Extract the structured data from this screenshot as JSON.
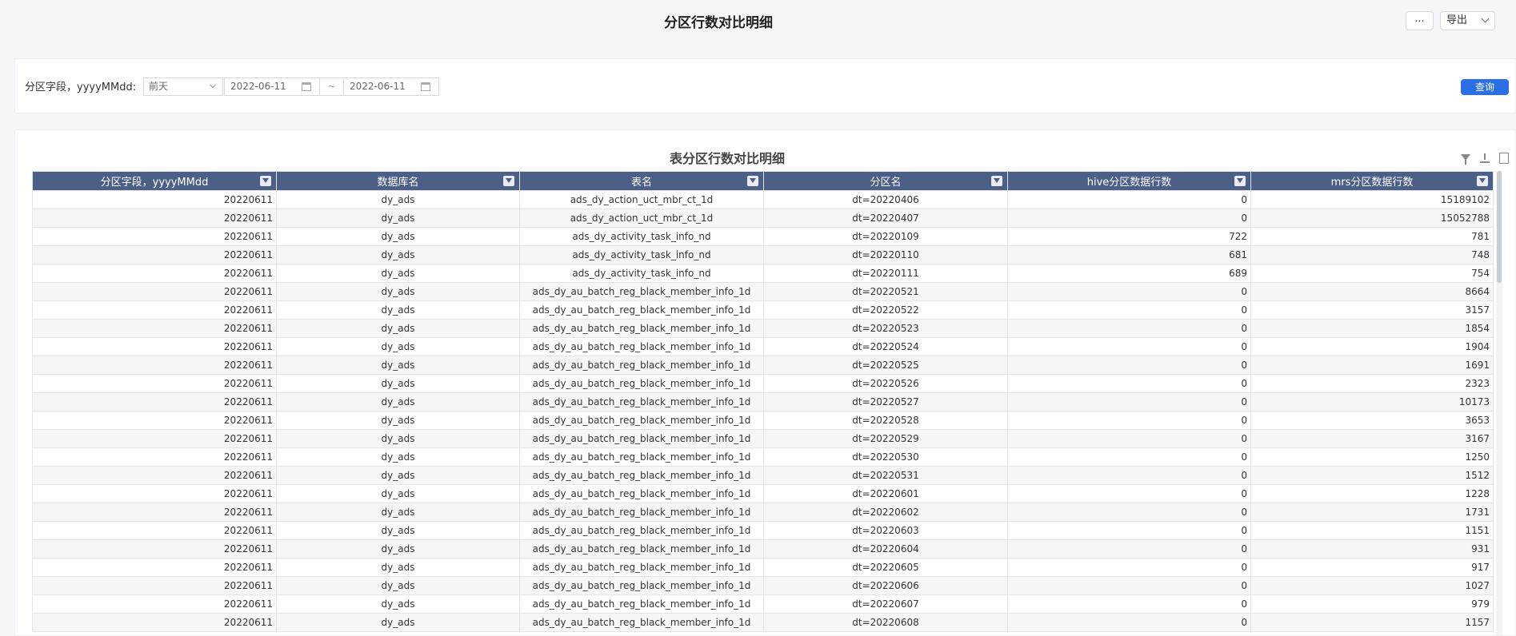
{
  "page": {
    "title": "分区行数对比明细",
    "more_label": "...",
    "export_label": "导出"
  },
  "filter": {
    "label": "分区字段，yyyyMMdd:",
    "preset": "前天",
    "start_date": "2022-06-11",
    "separator": "~",
    "end_date": "2022-06-11",
    "query_label": "查询"
  },
  "table": {
    "title": "表分区行数对比明细",
    "columns": [
      "分区字段，yyyyMMdd",
      "数据库名",
      "表名",
      "分区名",
      "hive分区数据行数",
      "mrs分区数据行数"
    ],
    "rows": [
      [
        "20220611",
        "dy_ads",
        "ads_dy_action_uct_mbr_ct_1d",
        "dt=20220406",
        "0",
        "15189102"
      ],
      [
        "20220611",
        "dy_ads",
        "ads_dy_action_uct_mbr_ct_1d",
        "dt=20220407",
        "0",
        "15052788"
      ],
      [
        "20220611",
        "dy_ads",
        "ads_dy_activity_task_info_nd",
        "dt=20220109",
        "722",
        "781"
      ],
      [
        "20220611",
        "dy_ads",
        "ads_dy_activity_task_info_nd",
        "dt=20220110",
        "681",
        "748"
      ],
      [
        "20220611",
        "dy_ads",
        "ads_dy_activity_task_info_nd",
        "dt=20220111",
        "689",
        "754"
      ],
      [
        "20220611",
        "dy_ads",
        "ads_dy_au_batch_reg_black_member_info_1d",
        "dt=20220521",
        "0",
        "8664"
      ],
      [
        "20220611",
        "dy_ads",
        "ads_dy_au_batch_reg_black_member_info_1d",
        "dt=20220522",
        "0",
        "3157"
      ],
      [
        "20220611",
        "dy_ads",
        "ads_dy_au_batch_reg_black_member_info_1d",
        "dt=20220523",
        "0",
        "1854"
      ],
      [
        "20220611",
        "dy_ads",
        "ads_dy_au_batch_reg_black_member_info_1d",
        "dt=20220524",
        "0",
        "1904"
      ],
      [
        "20220611",
        "dy_ads",
        "ads_dy_au_batch_reg_black_member_info_1d",
        "dt=20220525",
        "0",
        "1691"
      ],
      [
        "20220611",
        "dy_ads",
        "ads_dy_au_batch_reg_black_member_info_1d",
        "dt=20220526",
        "0",
        "2323"
      ],
      [
        "20220611",
        "dy_ads",
        "ads_dy_au_batch_reg_black_member_info_1d",
        "dt=20220527",
        "0",
        "10173"
      ],
      [
        "20220611",
        "dy_ads",
        "ads_dy_au_batch_reg_black_member_info_1d",
        "dt=20220528",
        "0",
        "3653"
      ],
      [
        "20220611",
        "dy_ads",
        "ads_dy_au_batch_reg_black_member_info_1d",
        "dt=20220529",
        "0",
        "3167"
      ],
      [
        "20220611",
        "dy_ads",
        "ads_dy_au_batch_reg_black_member_info_1d",
        "dt=20220530",
        "0",
        "1250"
      ],
      [
        "20220611",
        "dy_ads",
        "ads_dy_au_batch_reg_black_member_info_1d",
        "dt=20220531",
        "0",
        "1512"
      ],
      [
        "20220611",
        "dy_ads",
        "ads_dy_au_batch_reg_black_member_info_1d",
        "dt=20220601",
        "0",
        "1228"
      ],
      [
        "20220611",
        "dy_ads",
        "ads_dy_au_batch_reg_black_member_info_1d",
        "dt=20220602",
        "0",
        "1731"
      ],
      [
        "20220611",
        "dy_ads",
        "ads_dy_au_batch_reg_black_member_info_1d",
        "dt=20220603",
        "0",
        "1151"
      ],
      [
        "20220611",
        "dy_ads",
        "ads_dy_au_batch_reg_black_member_info_1d",
        "dt=20220604",
        "0",
        "931"
      ],
      [
        "20220611",
        "dy_ads",
        "ads_dy_au_batch_reg_black_member_info_1d",
        "dt=20220605",
        "0",
        "917"
      ],
      [
        "20220611",
        "dy_ads",
        "ads_dy_au_batch_reg_black_member_info_1d",
        "dt=20220606",
        "0",
        "1027"
      ],
      [
        "20220611",
        "dy_ads",
        "ads_dy_au_batch_reg_black_member_info_1d",
        "dt=20220607",
        "0",
        "979"
      ],
      [
        "20220611",
        "dy_ads",
        "ads_dy_au_batch_reg_black_member_info_1d",
        "dt=20220608",
        "0",
        "1157"
      ]
    ]
  },
  "icons": {
    "tool_filter": "filter-icon",
    "tool_download": "download-icon",
    "tool_chart": "chart-icon",
    "calendar": "calendar-icon",
    "column_filter": "column-filter-icon"
  },
  "colors": {
    "header_bg": "#4b5f87",
    "query_button": "#2b6fe6",
    "row_stripe": "#f5f6f8"
  }
}
